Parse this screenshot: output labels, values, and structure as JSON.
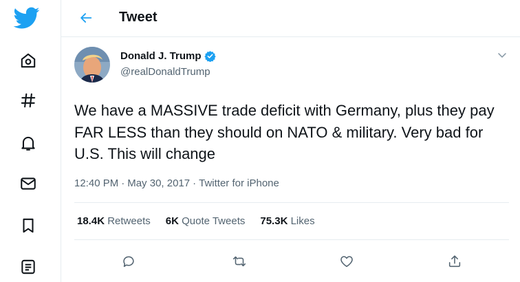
{
  "header": {
    "title": "Tweet"
  },
  "nav": {
    "items": [
      {
        "name": "twitter-logo-icon"
      },
      {
        "name": "home-icon"
      },
      {
        "name": "explore-hashtag-icon"
      },
      {
        "name": "notifications-bell-icon"
      },
      {
        "name": "messages-envelope-icon"
      },
      {
        "name": "bookmarks-icon"
      },
      {
        "name": "lists-icon"
      }
    ]
  },
  "tweet": {
    "display_name": "Donald J. Trump",
    "handle": "@realDonaldTrump",
    "verified": true,
    "text": "We have a MASSIVE trade deficit with Germany, plus they pay FAR LESS than they should on NATO & military. Very bad for U.S. This will change",
    "time": "12:40 PM",
    "date": "May 30, 2017",
    "source": "Twitter for iPhone",
    "separator": "·",
    "stats": {
      "retweets_count": "18.4K",
      "retweets_label": "Retweets",
      "quote_count": "6K",
      "quote_label": "Quote Tweets",
      "likes_count": "75.3K",
      "likes_label": "Likes"
    }
  },
  "colors": {
    "brand_blue": "#1da1f2",
    "icon_gray": "#536471",
    "text_dark": "#0f1419",
    "border": "#e6ecf0"
  }
}
